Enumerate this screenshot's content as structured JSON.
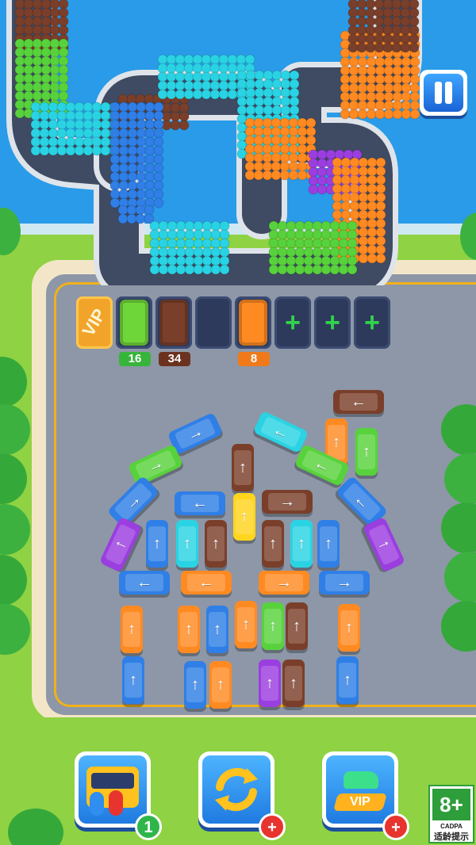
{
  "hud": {
    "pause_label": "Pause"
  },
  "parking": {
    "vip_label": "VIP",
    "slots": [
      {
        "kind": "vip",
        "label": "VIP"
      },
      {
        "kind": "bus",
        "color": "#6fd63a",
        "count": "16",
        "count_color": "#37b53a"
      },
      {
        "kind": "bus",
        "color": "#7a3f2a",
        "count": "34",
        "count_color": "#6b3220"
      },
      {
        "kind": "empty"
      },
      {
        "kind": "bus",
        "color": "#ff8a22",
        "count": "8",
        "count_color": "#f07a1a"
      },
      {
        "kind": "locked",
        "symbol": "+"
      },
      {
        "kind": "locked",
        "symbol": "+"
      },
      {
        "kind": "locked",
        "symbol": "+"
      }
    ],
    "counts": {
      "green": "16",
      "brown": "34",
      "orange": "8"
    }
  },
  "colors": {
    "blue": "#2f7fe6",
    "cyan": "#2ad3e3",
    "green": "#58d23c",
    "orange": "#ff8a22",
    "brown": "#7a3f2a",
    "purple": "#9b3ee0",
    "yellow": "#ffd51e"
  },
  "buses": [
    {
      "c": "brown",
      "dir": "←"
    },
    {
      "c": "blue",
      "dir": "↗"
    },
    {
      "c": "cyan",
      "dir": "↘"
    },
    {
      "c": "orange",
      "dir": "↑"
    },
    {
      "c": "green",
      "dir": "↑"
    },
    {
      "c": "green",
      "dir": "↗"
    },
    {
      "c": "brown",
      "dir": "↑"
    },
    {
      "c": "green",
      "dir": "↖"
    },
    {
      "c": "blue",
      "dir": "↗"
    },
    {
      "c": "blue",
      "dir": "←"
    },
    {
      "c": "yellow",
      "dir": "↑"
    },
    {
      "c": "brown",
      "dir": "→"
    },
    {
      "c": "blue",
      "dir": "↖"
    },
    {
      "c": "purple",
      "dir": "↑"
    },
    {
      "c": "blue",
      "dir": "↑"
    },
    {
      "c": "cyan",
      "dir": "↑"
    },
    {
      "c": "brown",
      "dir": "↑"
    },
    {
      "c": "brown",
      "dir": "↑"
    },
    {
      "c": "cyan",
      "dir": "↑"
    },
    {
      "c": "blue",
      "dir": "↑"
    },
    {
      "c": "purple",
      "dir": "↑"
    },
    {
      "c": "blue",
      "dir": "←"
    },
    {
      "c": "orange",
      "dir": "←"
    },
    {
      "c": "orange",
      "dir": "→"
    },
    {
      "c": "blue",
      "dir": "→"
    },
    {
      "c": "orange",
      "dir": "↑"
    },
    {
      "c": "orange",
      "dir": "↑"
    },
    {
      "c": "blue",
      "dir": "↑"
    },
    {
      "c": "orange",
      "dir": "↑"
    },
    {
      "c": "green",
      "dir": "↑"
    },
    {
      "c": "brown",
      "dir": "↑"
    },
    {
      "c": "orange",
      "dir": "↑"
    },
    {
      "c": "blue",
      "dir": "↑"
    },
    {
      "c": "blue",
      "dir": "↑"
    },
    {
      "c": "orange",
      "dir": "↑"
    },
    {
      "c": "purple",
      "dir": "↑"
    },
    {
      "c": "brown",
      "dir": "↑"
    },
    {
      "c": "blue",
      "dir": "↑"
    }
  ],
  "boosters": [
    {
      "name": "move-passengers",
      "badge": "1",
      "badge_color": "#2fb64a"
    },
    {
      "name": "shuffle",
      "badge": "+",
      "badge_color": "#e8342e"
    },
    {
      "name": "vip",
      "badge": "+",
      "badge_color": "#e8342e",
      "label": "VIP"
    }
  ],
  "age_rating": {
    "rating": "8+",
    "org": "CADPA",
    "tip": "适龄提示"
  }
}
